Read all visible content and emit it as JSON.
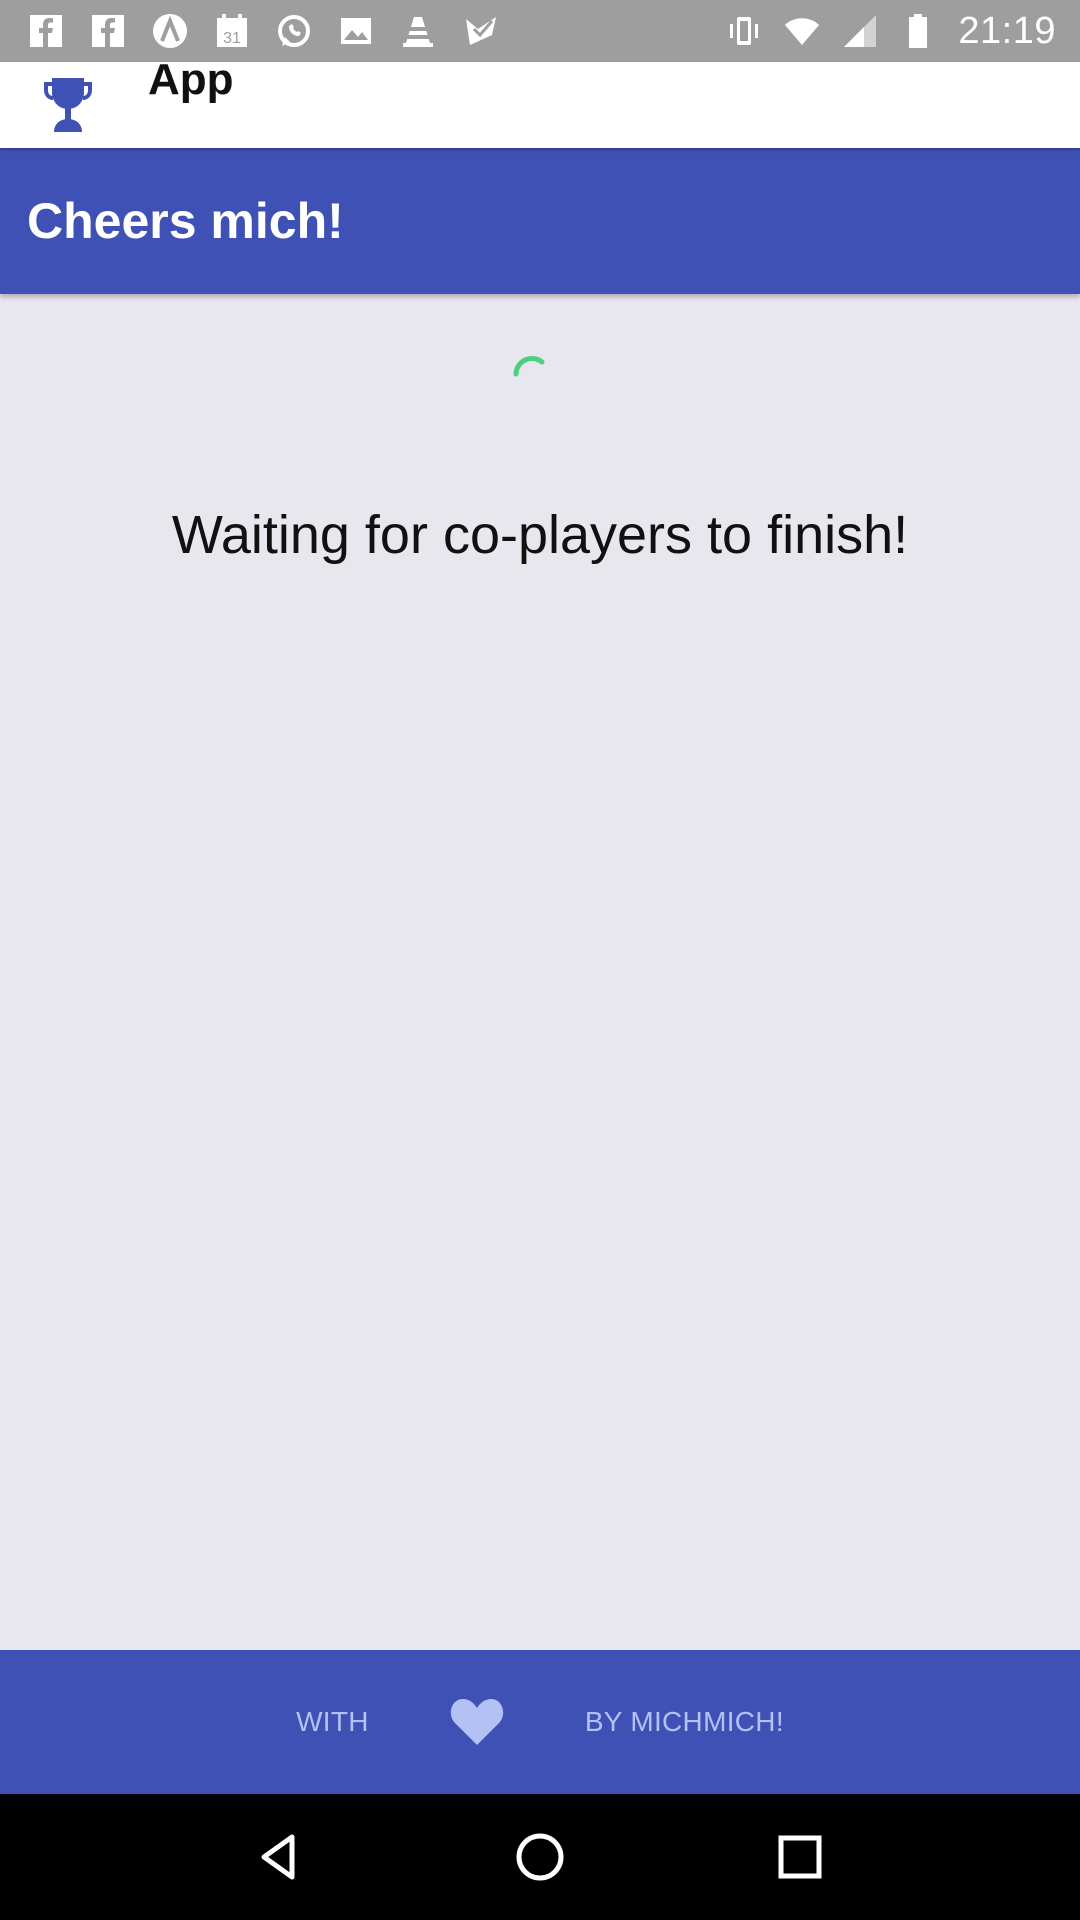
{
  "status_bar": {
    "time": "21:19",
    "left_icons": [
      "facebook-icon",
      "facebook-icon",
      "app-icon",
      "calendar-icon",
      "whatsapp-icon",
      "gallery-icon",
      "vlc-icon",
      "check-icon"
    ],
    "calendar_day": "31",
    "right_icons": [
      "vibrate-icon",
      "wifi-icon",
      "signal-icon",
      "battery-icon"
    ]
  },
  "app_bar": {
    "title": "App",
    "icon": "trophy-icon",
    "icon_color": "#3f51b5"
  },
  "header": {
    "title": "Cheers mich!",
    "color": "#3f51b5"
  },
  "main": {
    "message": "Waiting for co-players to finish!",
    "spinner_color": "#4cd080"
  },
  "footer": {
    "left_text": "WITH",
    "icon": "heart-icon",
    "right_text": "BY MICHMICH!",
    "text_color": "#b3c1f5"
  },
  "nav_bar": {
    "buttons": [
      "back-icon",
      "home-icon",
      "recents-icon"
    ]
  }
}
